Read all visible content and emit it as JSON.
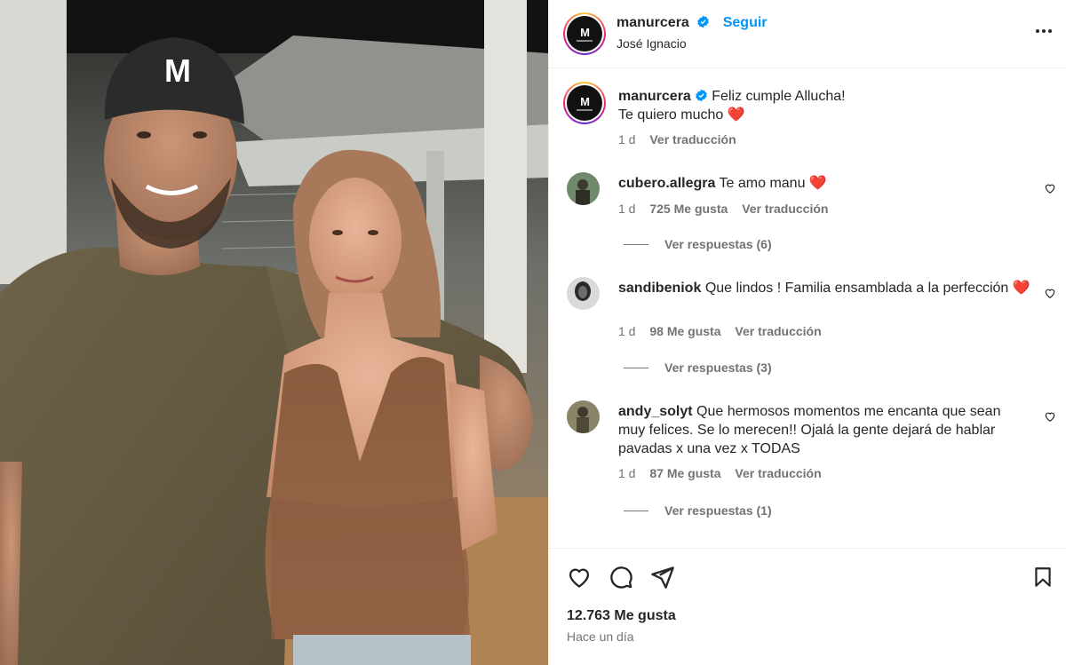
{
  "post": {
    "username": "manurcera",
    "follow_label": "Seguir",
    "location": "José Ignacio",
    "more_icon": "more-horizontal-icon"
  },
  "caption": {
    "username": "manurcera",
    "line1": "Feliz cumple Allucha!",
    "line2": "Te quiero mucho",
    "emoji": "❤️",
    "time": "1 d",
    "translate": "Ver traducción"
  },
  "comments": [
    {
      "username": "cubero.allegra",
      "text": "Te amo manu",
      "emoji": "❤️",
      "time": "1 d",
      "likes": "725 Me gusta",
      "translate": "Ver traducción",
      "replies": "Ver respuestas (6)"
    },
    {
      "username": "sandibeniok",
      "text": "Que lindos ! Familia ensamblada a la perfección",
      "emoji": "❤️",
      "time": "1 d",
      "likes": "98 Me gusta",
      "translate": "Ver traducción",
      "replies": "Ver respuestas (3)"
    },
    {
      "username": "andy_solyt",
      "text": "Que hermosos momentos me encanta que sean muy felices. Se lo merecen!! Ojalá la gente dejará de hablar pavadas x una vez x TODAS",
      "time": "1 d",
      "likes": "87 Me gusta",
      "translate": "Ver traducción",
      "replies": "Ver respuestas (1)"
    }
  ],
  "footer": {
    "likes": "12.763 Me gusta",
    "time": "Hace un día"
  },
  "colors": {
    "accent": "#0095f6",
    "text": "#262626",
    "muted": "#737373",
    "heart": "#e0245e"
  }
}
